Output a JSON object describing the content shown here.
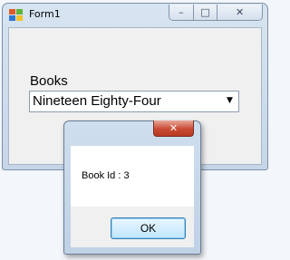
{
  "window": {
    "title": "Form1",
    "icon": "windows-form-icon",
    "controls": {
      "minimize": "–",
      "maximize": "□",
      "close": "✕"
    }
  },
  "form": {
    "books_label": "Books",
    "books_combo": {
      "selected": "Nineteen Eighty-Four",
      "arrow": "▼"
    }
  },
  "message_box": {
    "close_glyph": "✕",
    "message": "Book Id : 3",
    "ok_label": "OK"
  }
}
